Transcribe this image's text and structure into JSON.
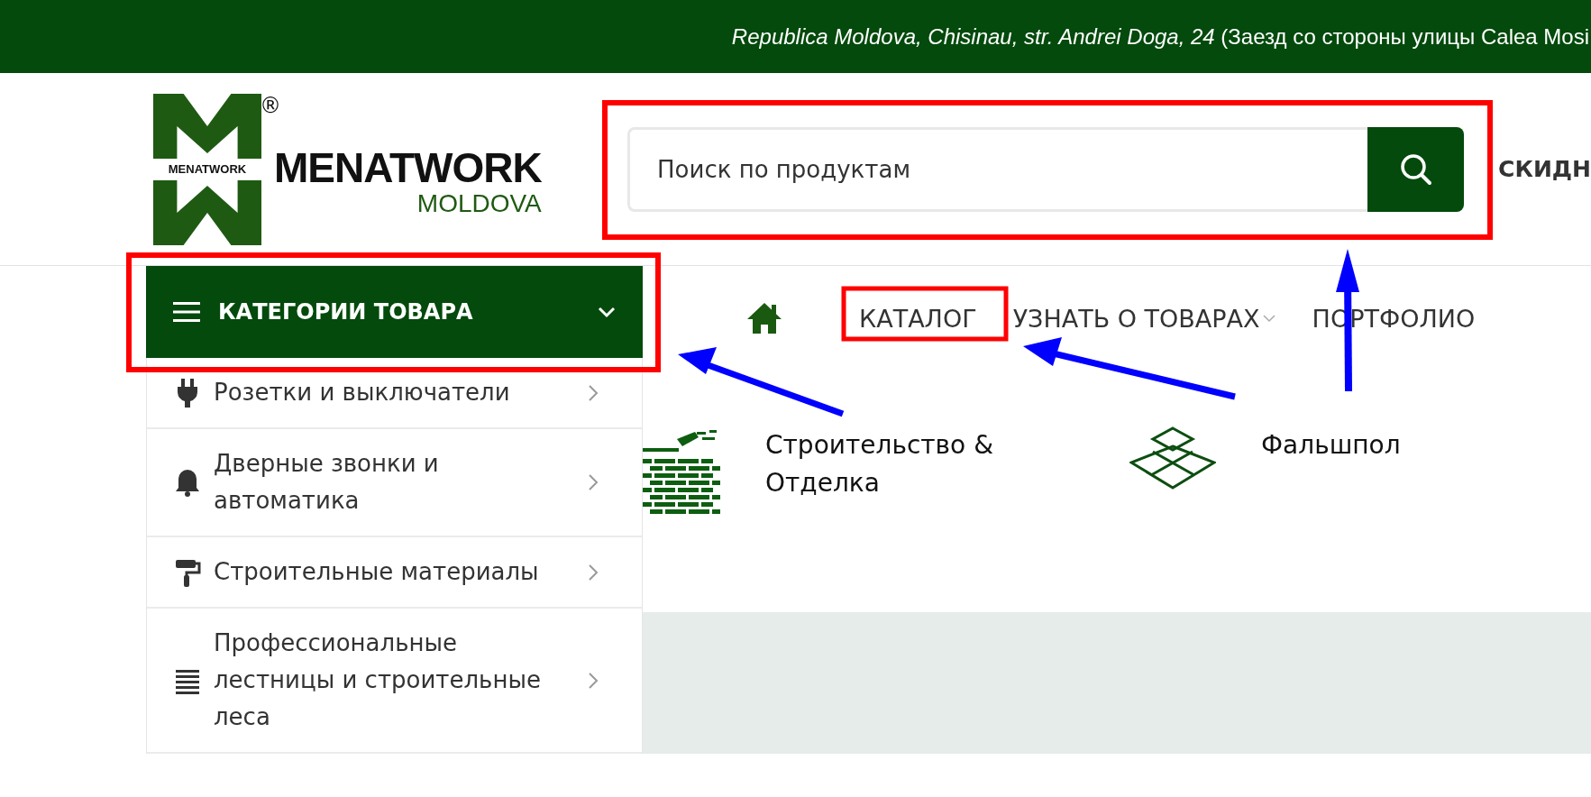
{
  "top_bar": {
    "address": "*Republica Moldova, Chisinau, str. Andrei Doga, 24* (Заезд со стороны улицы Calea Mosi"
  },
  "logo": {
    "registered": "®",
    "band": "MENATWORK",
    "name": "MENATWORK",
    "subtitle": "MOLDOVA"
  },
  "search": {
    "placeholder": "Поиск по продуктам"
  },
  "header_link": "СКИДН",
  "categories_button": {
    "label": "КАТЕГОРИИ ТОВАРА",
    "expanded": true
  },
  "categories": [
    {
      "label": "Розетки и выключатели"
    },
    {
      "label": "Дверные звонки и автоматика"
    },
    {
      "label": "Строительные материалы"
    },
    {
      "label": "Профессиональные лестницы и строительные леса"
    }
  ],
  "nav": [
    {
      "label": "КАТАЛОГ",
      "kind": "link"
    },
    {
      "label": "УЗНАТЬ О ТОВАРАХ",
      "kind": "dropdown"
    },
    {
      "label": "ПОРТФОЛИО",
      "kind": "link"
    }
  ],
  "tiles": [
    {
      "label": "Строительство & Отделка"
    },
    {
      "label": "Фальшпол"
    }
  ]
}
